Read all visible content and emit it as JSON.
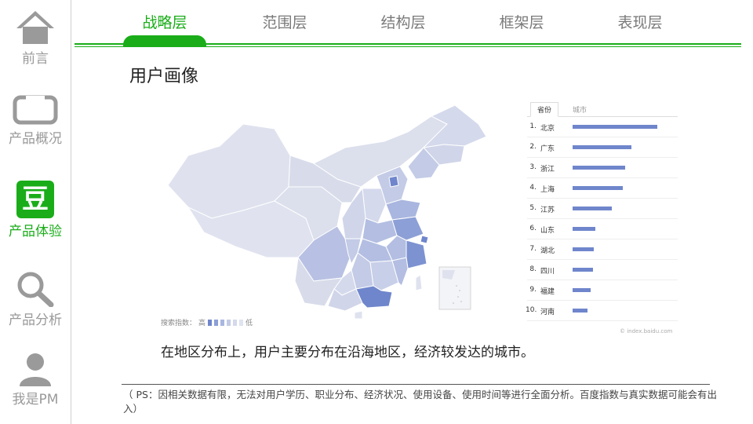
{
  "sidebar": {
    "items": [
      {
        "label": "前言",
        "icon": "home-icon",
        "active": false
      },
      {
        "label": "产品概况",
        "icon": "tablet-icon",
        "active": false
      },
      {
        "label": "产品体验",
        "icon": "douban-icon",
        "icon_text": "豆",
        "active": true
      },
      {
        "label": "产品分析",
        "icon": "search-icon",
        "active": false
      },
      {
        "label": "我是PM",
        "icon": "user-icon",
        "active": false
      }
    ]
  },
  "tabs": [
    {
      "label": "战略层",
      "active": true
    },
    {
      "label": "范围层",
      "active": false
    },
    {
      "label": "结构层",
      "active": false
    },
    {
      "label": "框架层",
      "active": false
    },
    {
      "label": "表现层",
      "active": false
    }
  ],
  "accent_color": "#1aad19",
  "section_title": "用户画像",
  "map": {
    "legend_label": "搜索指数：",
    "legend_high": "高",
    "legend_low": "低",
    "colors": [
      "#6f86cc",
      "#8c9fd6",
      "#a9b6df",
      "#c3cbe6",
      "#d4d9ec",
      "#e0e3ef"
    ]
  },
  "ranking": {
    "tabs": [
      "省份",
      "城市"
    ],
    "active_tab": "省份",
    "rows": [
      {
        "rank": "1.",
        "name": "北京",
        "value": 1.0
      },
      {
        "rank": "2.",
        "name": "广东",
        "value": 0.69
      },
      {
        "rank": "3.",
        "name": "浙江",
        "value": 0.62
      },
      {
        "rank": "4.",
        "name": "上海",
        "value": 0.59
      },
      {
        "rank": "5.",
        "name": "江苏",
        "value": 0.46
      },
      {
        "rank": "6.",
        "name": "山东",
        "value": 0.27
      },
      {
        "rank": "7.",
        "name": "湖北",
        "value": 0.25
      },
      {
        "rank": "8.",
        "name": "四川",
        "value": 0.24
      },
      {
        "rank": "9.",
        "name": "福建",
        "value": 0.21
      },
      {
        "rank": "10.",
        "name": "河南",
        "value": 0.18
      }
    ],
    "bar_color": "#6f86cc",
    "source": "© index.baidu.com"
  },
  "summary": "在地区分布上，用户主要分布在沿海地区，经济较发达的城市。",
  "note": "（ PS：因相关数据有限，无法对用户学历、职业分布、经济状况、使用设备、使用时间等进行全面分析。百度指数与真实数据可能会有出入）"
}
